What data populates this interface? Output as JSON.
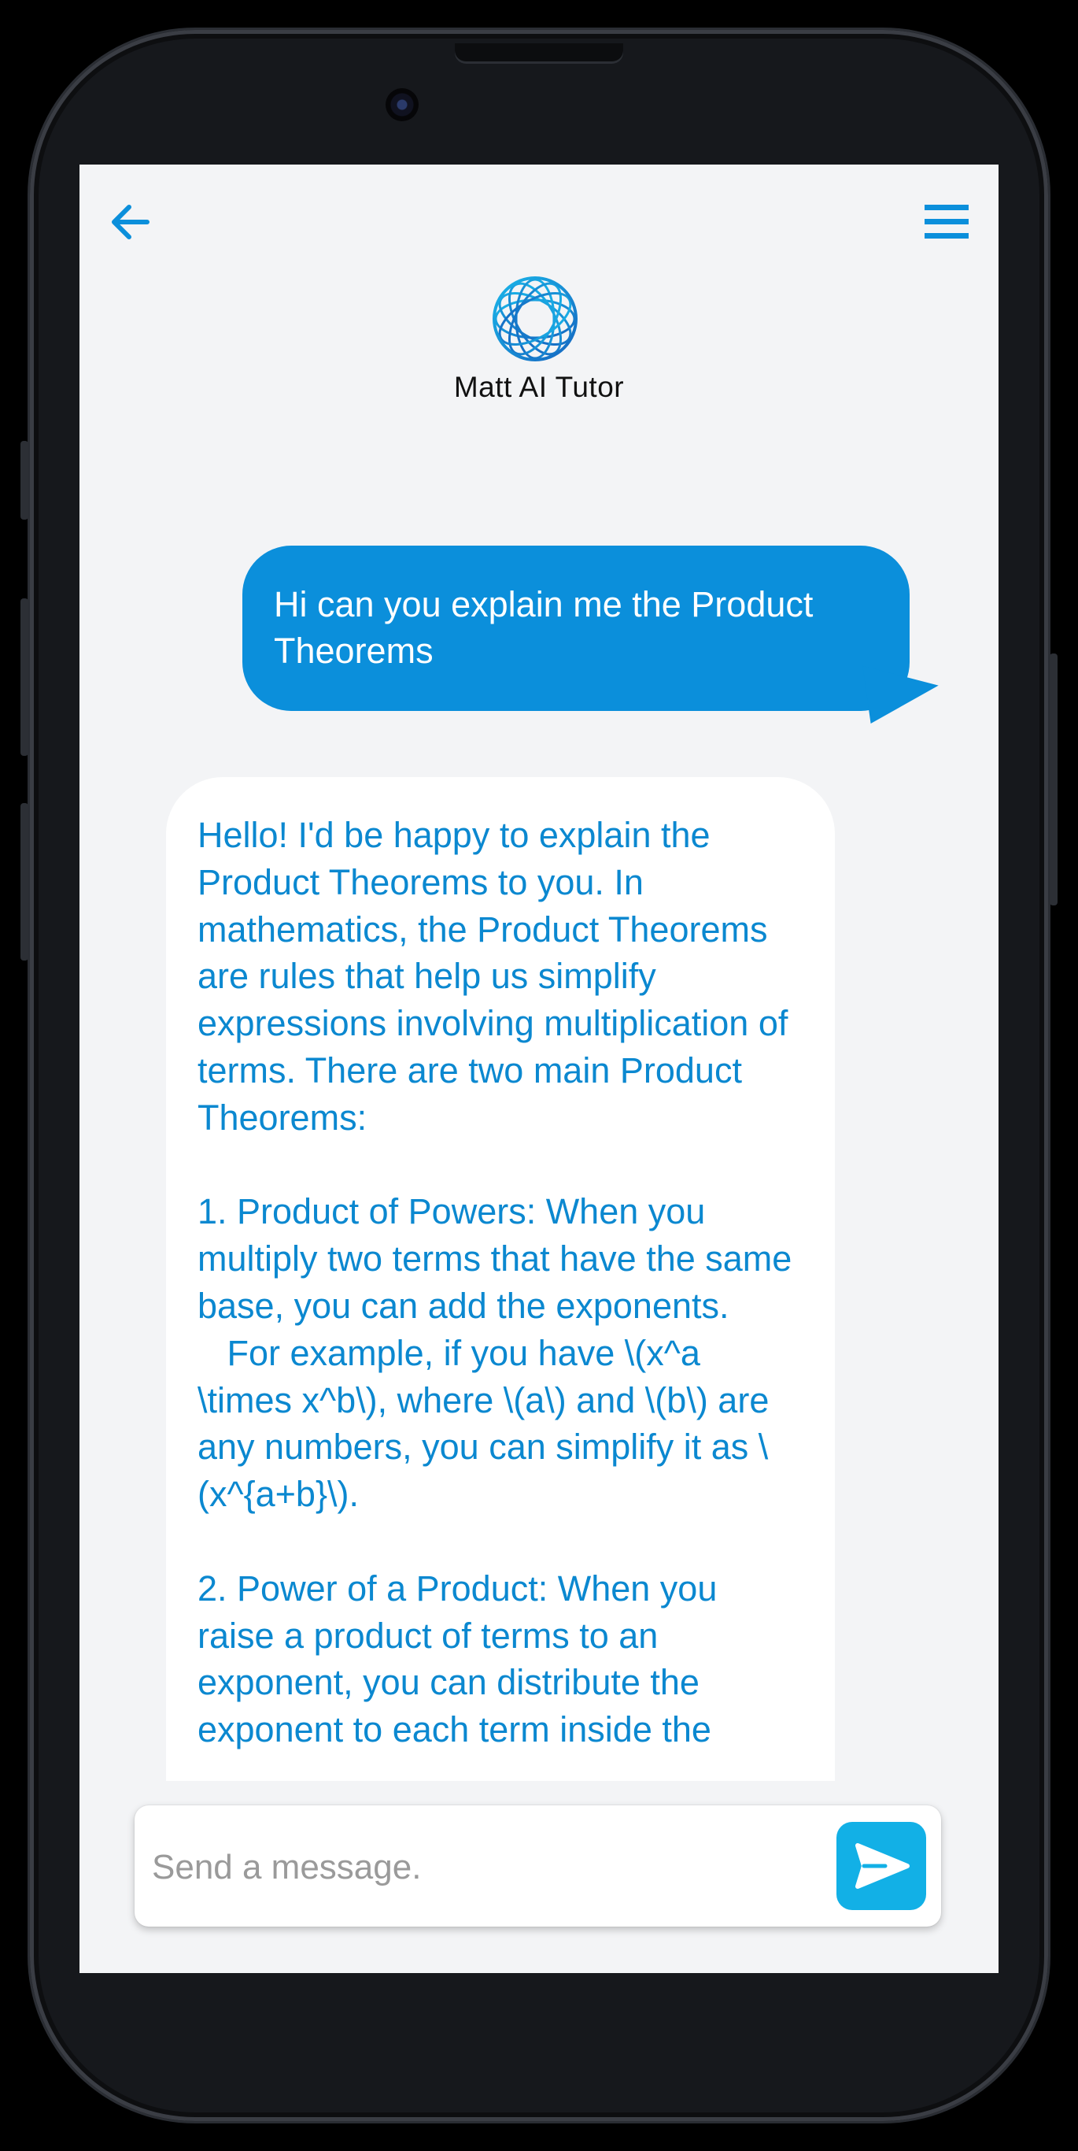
{
  "header": {
    "back_icon": "arrow-left-icon",
    "menu_icon": "hamburger-menu-icon",
    "logo_icon": "tutor-logo-icon",
    "title": "Matt AI Tutor"
  },
  "messages": [
    {
      "role": "user",
      "text": "Hi can you explain me the Product Theorems"
    },
    {
      "role": "assistant",
      "text": "Hello! I'd be happy to explain the Product Theorems to you. In mathematics, the Product Theorems are rules that help us simplify expressions involving multiplication of terms. There are two main Product Theorems:\n\n1. Product of Powers: When you multiply two terms that have the same base, you can add the exponents.\n   For example, if you have \\(x^a \\times x^b\\), where \\(a\\) and \\(b\\) are any numbers, you can simplify it as \\(x^{a+b}\\).\n\n2. Power of a Product: When you raise a product of terms to an exponent, you can distribute the exponent to each term inside the"
    }
  ],
  "composer": {
    "placeholder": "Send a message.",
    "value": "",
    "send_icon": "send-icon"
  },
  "colors": {
    "accent": "#0b8fdb",
    "assistant_text": "#0b88d0",
    "send_button": "#12b0e6",
    "background": "#f3f4f6"
  }
}
